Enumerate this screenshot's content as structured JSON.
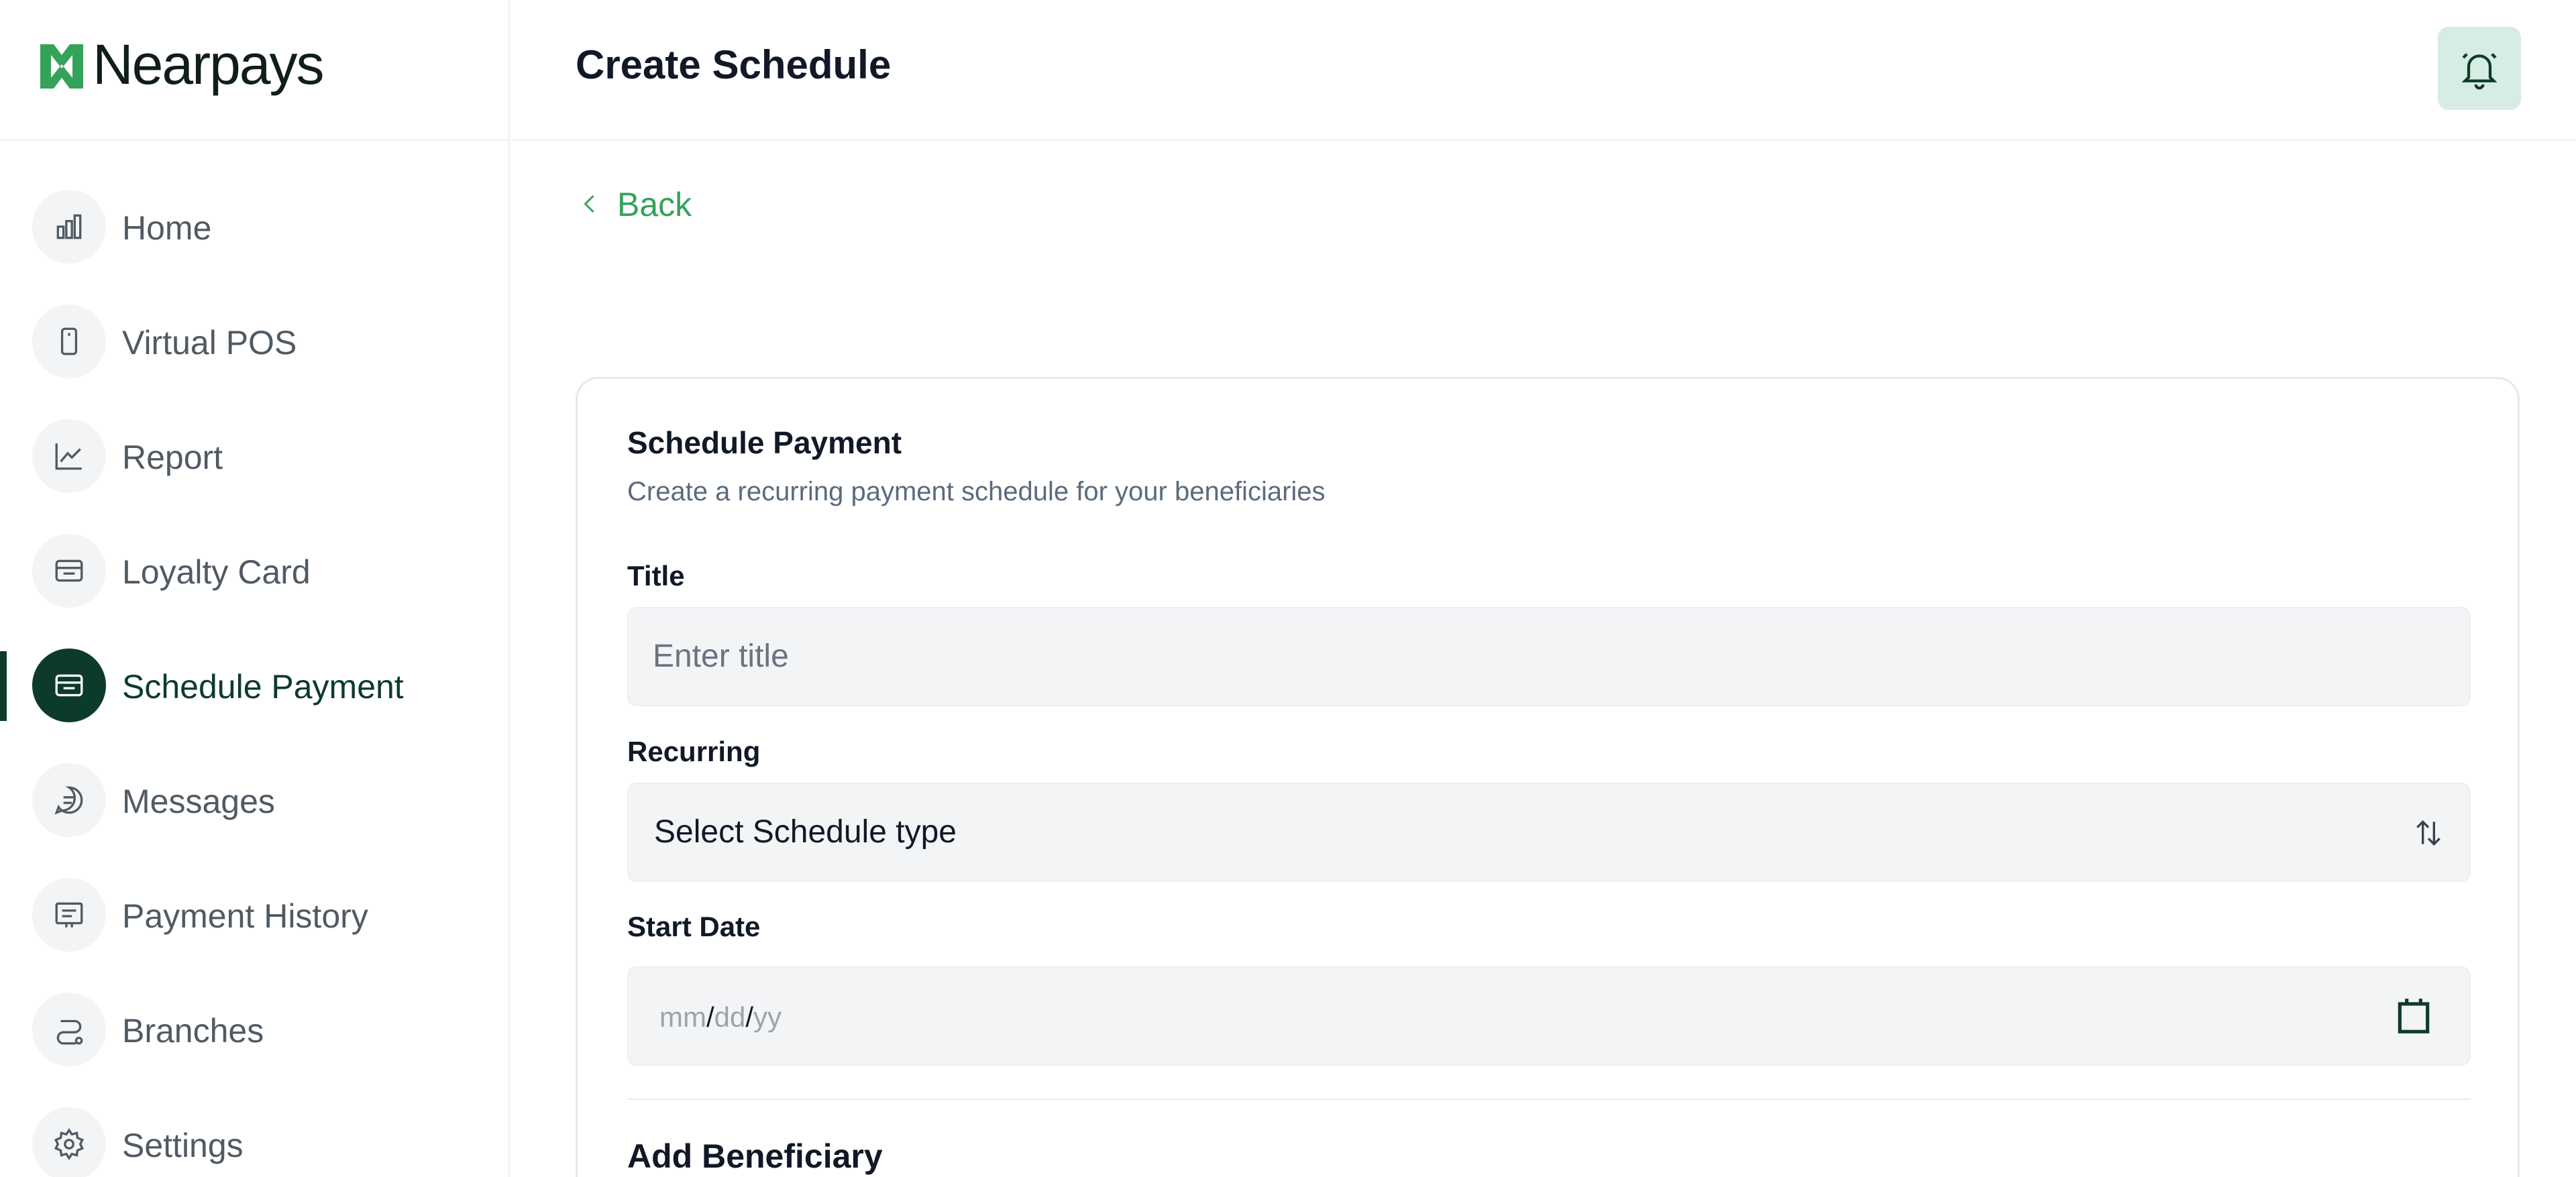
{
  "brand": {
    "name": "Nearpays",
    "accent": "#35a25a",
    "dark": "#0c3b2a"
  },
  "sidebar": {
    "items": [
      {
        "label": "Home",
        "icon": "bar-chart-icon",
        "active": false
      },
      {
        "label": "Virtual POS",
        "icon": "phone-icon",
        "active": false
      },
      {
        "label": "Report",
        "icon": "line-chart-icon",
        "active": false
      },
      {
        "label": "Loyalty Card",
        "icon": "card-icon",
        "active": false
      },
      {
        "label": "Schedule Payment",
        "icon": "card-icon",
        "active": true
      },
      {
        "label": "Messages",
        "icon": "chat-icon",
        "active": false
      },
      {
        "label": "Payment History",
        "icon": "receipt-icon",
        "active": false
      },
      {
        "label": "Branches",
        "icon": "route-icon",
        "active": false
      },
      {
        "label": "Settings",
        "icon": "gear-icon",
        "active": false
      }
    ]
  },
  "header": {
    "title": "Create Schedule",
    "notification_icon": "bell-icon"
  },
  "back": {
    "label": "Back"
  },
  "form": {
    "title": "Schedule Payment",
    "subtitle": "Create a recurring payment schedule for your beneficiaries",
    "title_field": {
      "label": "Title",
      "placeholder": "Enter title"
    },
    "recurring_field": {
      "label": "Recurring",
      "value": "Select Schedule type"
    },
    "start_date_field": {
      "label": "Start Date",
      "mm": "mm",
      "dd": "dd",
      "yy": "yy",
      "sep": "/"
    },
    "beneficiary_section": "Add Beneficiary"
  }
}
